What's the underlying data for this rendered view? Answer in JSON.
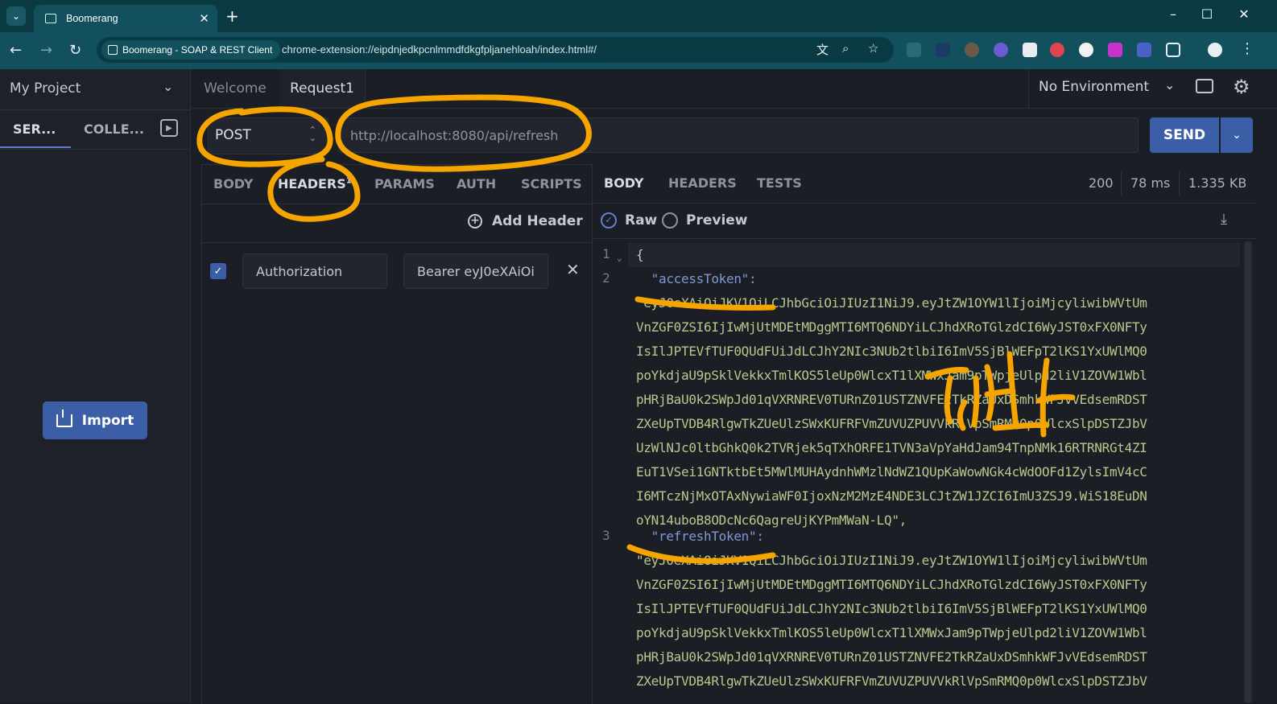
{
  "browser": {
    "tab_title": "Boomerang",
    "tab_close": "✕",
    "new_tab": "+",
    "site_chip": "Boomerang - SOAP & REST Client",
    "url": "chrome-extension://eipdnjedkpcnlmmdfdkgfpljanehloah/index.html#/",
    "window_controls": [
      "–",
      "☐",
      "✕"
    ]
  },
  "sidebar": {
    "project": "My Project",
    "tabs": [
      "SER...",
      "COLLE..."
    ],
    "import_label": "Import"
  },
  "doc_tabs": [
    "Welcome",
    "Request1"
  ],
  "environment": "No Environment",
  "request": {
    "method": "POST",
    "url": "http://localhost:8080/api/refresh",
    "send_label": "SEND",
    "tabs": [
      "BODY",
      "HEADERS",
      "PARAMS",
      "AUTH",
      "SCRIPTS"
    ],
    "headers_badge": "1",
    "add_header_label": "Add Header",
    "header_key": "Authorization",
    "header_value": "Bearer eyJ0eXAiOi"
  },
  "response": {
    "tabs": [
      "BODY",
      "HEADERS",
      "TESTS"
    ],
    "status": "200",
    "time": "78 ms",
    "size": "1.335 KB",
    "view_raw": "Raw",
    "view_preview": "Preview",
    "line_numbers": [
      "1",
      "2",
      "3"
    ],
    "open_brace": "{",
    "access_key": "  \"accessToken\":",
    "access_lines": [
      "\"eyJ0eXAiOiJKV1QiLCJhbGciOiJIUzI1NiJ9.eyJtZW1OYW1lIjoiMjcyliwibWVtUm",
      "VnZGF0ZSI6IjIwMjUtMDEtMDggMTI6MTQ6NDYiLCJhdXRoTGlzdCI6WyJST0xFX0NFTy",
      "IsIlJPTEVfTUF0QUdFUiJdLCJhY2NIc3NUb2tlbiI6ImV5SjBlWEFpT2lKS1YxUWlMQ0",
      "poYkdjaU9pSklVekkxTmlKOS5leUp0WlcxT1lXMWxJam9pTWpjeUlpd2liV1ZOVW1Wbl",
      "pHRjBaU0k2SWpJd01qVXRNREV0TURnZ01USTZNVFE2TkRZaUxDSmhkWFJvVEdsemRDST",
      "ZXeUpTVDB4RlgwTkZUeUlzSWxKUFRFVmZUVUZPUVVkRlVpSmRMQ0p0WlcxSlpDSTZJbV",
      "UzWlNJc0ltbGhkQ0k2TVRjek5qTXhORFE1TVN3aVpYaHdJam94TnpNMk16RTRNRGt4ZI",
      "EuT1VSei1GNTktbEt5MWlMUHAydnhWMzlNdWZ1QUpKaWowNGk4cWdOOFd1ZylsImV4cC",
      "I6MTczNjMxOTAxNywiaWF0IjoxNzM2MzE4NDE3LCJtZW1JZCI6ImU3ZSJ9.WiS18EuDN",
      "oYN14uboB8ODcNc6QagreUjKYPmMWaN-LQ\","
    ],
    "refresh_key": "  \"refreshToken\":",
    "refresh_lines": [
      "\"eyJ0eXAiOiJKV1QiLCJhbGciOiJIUzI1NiJ9.eyJtZW1OYW1lIjoiMjcyliwibWVtUm",
      "VnZGF0ZSI6IjIwMjUtMDEtMDggMTI6MTQ6NDYiLCJhdXRoTGlzdCI6WyJST0xFX0NFTy",
      "IsIlJPTEVfTUF0QUdFUiJdLCJhY2NIc3NUb2tlbiI6ImV5SjBlWEFpT2lKS1YxUWlMQ0",
      "poYkdjaU9pSklVekkxTmlKOS5leUp0WlcxT1lXMWxJam9pTWpjeUlpd2liV1ZOVW1Wbl",
      "pHRjBaU0k2SWpJd01qVXRNREV0TURnZ01USTZNVFE2TkRZaUxDSmhkWFJvVEdsemRDST",
      "ZXeUpTVDB4RlgwTkZUeUlzSWxKUFRFVmZUVUZPUVVkRlVpSmRMQ0p0WlcxSlpDSTZJbV"
    ]
  },
  "colors": {
    "accent": "#3c5ea6",
    "annotation": "#f5a400",
    "chrome_frame": "#11505c",
    "json_key": "#7f9ad6",
    "json_string": "#b7c98d"
  }
}
